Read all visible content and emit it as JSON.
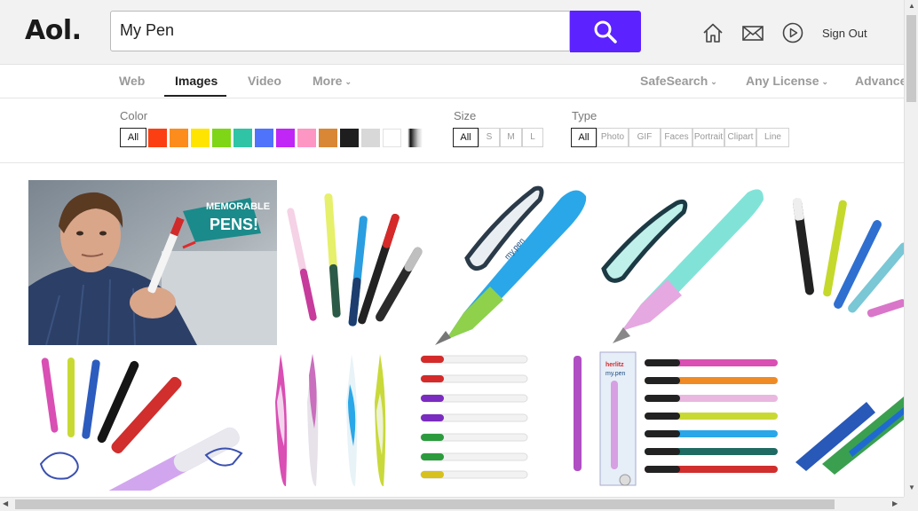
{
  "brand": {
    "logo_text": "Aol."
  },
  "search": {
    "query": "My Pen",
    "button_color": "#5c22ff"
  },
  "header": {
    "sign_out": "Sign Out",
    "icons": [
      "home-icon",
      "mail-icon",
      "play-icon"
    ]
  },
  "tabs": {
    "web": "Web",
    "images": "Images",
    "video": "Video",
    "more": "More",
    "safesearch": "SafeSearch",
    "license": "Any License",
    "advanced": "Advanced"
  },
  "filters": {
    "color_label": "Color",
    "color_all": "All",
    "colors": [
      "#fb3f12",
      "#fc8c1c",
      "#ffe400",
      "#7fd616",
      "#2ec4a5",
      "#4f73fb",
      "#c026f5",
      "#fd96c3",
      "#d98734",
      "#1e1e1e",
      "#d8d8d8",
      "#ffffff"
    ],
    "size_label": "Size",
    "sizes": [
      "All",
      "S",
      "M",
      "L"
    ],
    "type_label": "Type",
    "types": [
      "All",
      "Photo",
      "GIF",
      "Faces",
      "Portrait",
      "Clipart",
      "Line"
    ]
  },
  "results": {
    "ad_text_line1": "MEMORABLE",
    "ad_text_line2": "PENS!",
    "brand_on_pen": "my.pen",
    "card_brand": "herlitz",
    "card_brand_sub": "my.pen"
  }
}
